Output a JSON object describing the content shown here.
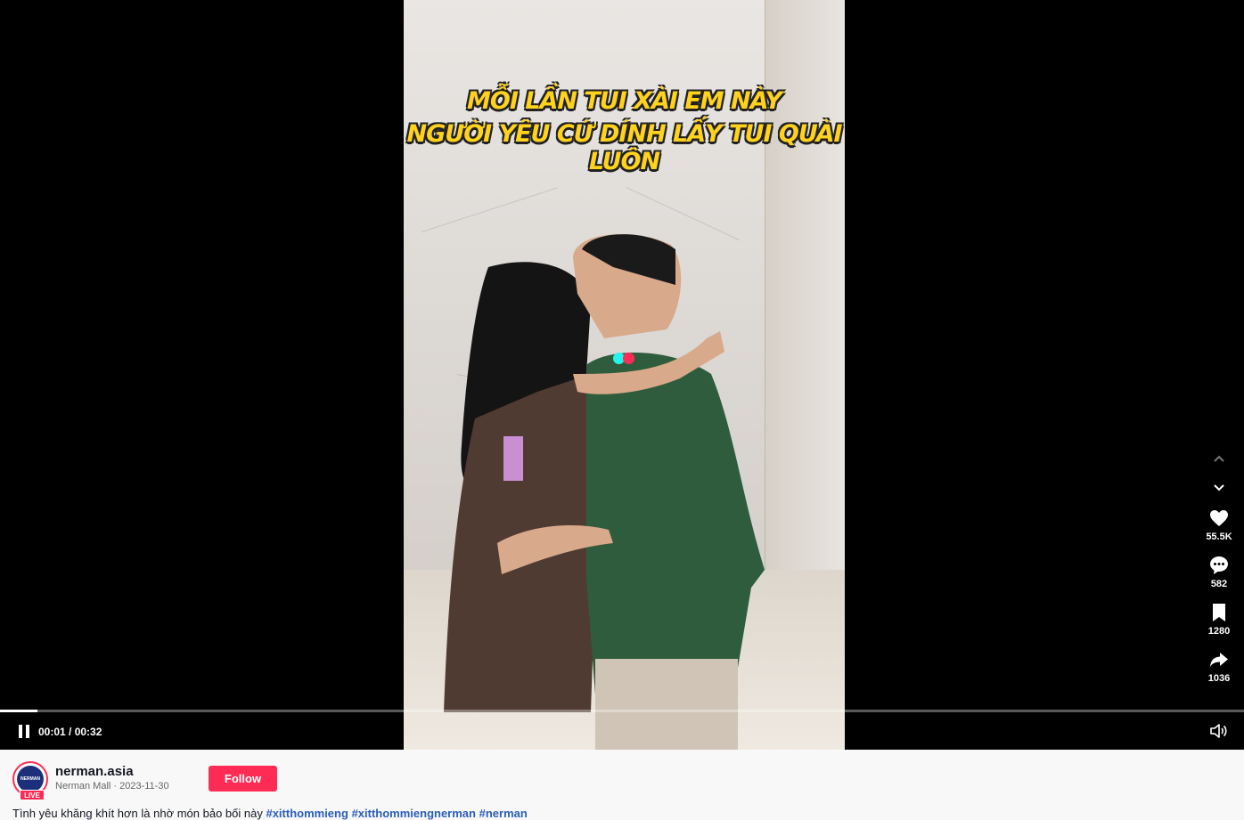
{
  "video": {
    "caption_line1": "MỖI LẦN TUI XÀI EM NÀY",
    "caption_line2": "NGƯỜI YÊU CỨ DÍNH LẤY TUI QUÀI LUÔN",
    "progress_fraction": 0.03
  },
  "controls": {
    "time": "00:01 / 00:32",
    "play_state_icon": "pause-icon",
    "volume_icon": "volume-icon"
  },
  "actions": {
    "like_count": "55.5K",
    "comment_count": "582",
    "save_count": "1280",
    "share_count": "1036"
  },
  "author": {
    "username": "nerman.asia",
    "subline": "Nerman Mall · 2023-11-30",
    "avatar_text": "NERMAN",
    "live_label": "LIVE",
    "follow_label": "Follow"
  },
  "description": {
    "text": "Tình yêu khăng khít hơn là nhờ món bảo bối này",
    "hashtags": [
      "#xitthommieng",
      "#xitthommiengnerman",
      "#nerman"
    ]
  },
  "colors": {
    "accent": "#fe2c55",
    "hashtag": "#2b5db9",
    "loader_cyan": "#25f4ee",
    "loader_red": "#fe2c55"
  }
}
